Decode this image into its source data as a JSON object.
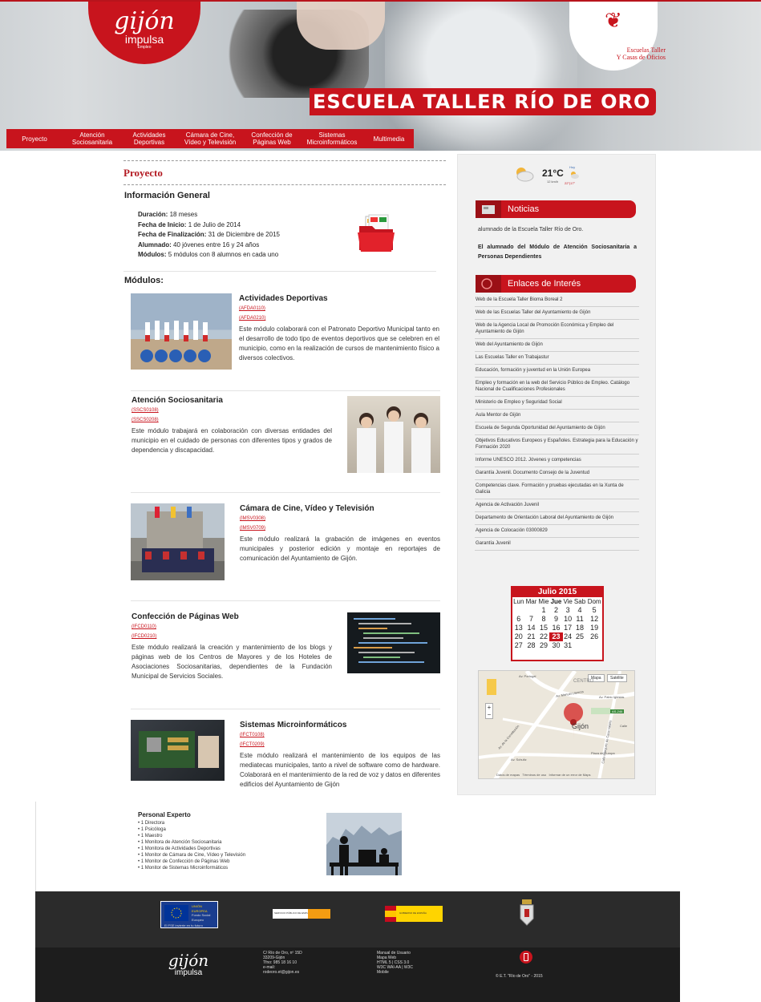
{
  "header": {
    "logo_gijon": {
      "main": "gijón",
      "sub": "impulsa",
      "tag": "Empleo"
    },
    "logo_et": {
      "line1": "Escuelas Taller",
      "line2": "Y Casas de Oficios"
    },
    "banner": "ESCUELA TALLER RÍO DE ORO"
  },
  "nav": {
    "items": [
      {
        "label": "Proyecto"
      },
      {
        "label": "Atención Sociosanitaria"
      },
      {
        "label": "Actividades Deportivas"
      },
      {
        "label": "Cámara de Cine, Vídeo y Televisión"
      },
      {
        "label": "Confección de Páginas Web"
      },
      {
        "label": "Sistemas Microinformáticos"
      },
      {
        "label": "Multimedia"
      }
    ]
  },
  "main": {
    "section_title": "Proyecto",
    "info_heading": "Información General",
    "info": [
      {
        "key": "Duración:",
        "value": " 18 meses"
      },
      {
        "key": "Fecha de Inicio:",
        "value": " 1 de Julio de 2014"
      },
      {
        "key": "Fecha de Finalización:",
        "value": " 31 de Diciembre de 2015"
      },
      {
        "key": "Alumnado:",
        "value": " 40 jóvenes entre 16 y 24 años"
      },
      {
        "key": "Módulos:",
        "value": " 5 módulos con 8 alumnos en cada uno"
      }
    ],
    "modules_heading": "Módulos:",
    "modules": [
      {
        "title": "Actividades Deportivas",
        "codes": [
          "(AFDA0110)",
          "(AFDA0210)"
        ],
        "desc": "Este módulo colaborará con el Patronato Deportivo Municipal tanto en el desarrollo de todo tipo de eventos deportivos que se celebren en el municipio, como en la realización de cursos de mantenimiento físico a diversos colectivos."
      },
      {
        "title": "Atención Sociosanitaria",
        "codes": [
          "(SSCS0108)",
          "(SSCS0208)"
        ],
        "desc": "Este módulo trabajará en colaboración con diversas entidades del municipio en el cuidado de personas con diferentes tipos y grados de dependencia y discapacidad."
      },
      {
        "title": "Cámara de Cine, Vídeo y Televisión",
        "codes": [
          "(IMSV0308)",
          "(IMSV0709)"
        ],
        "desc": "Este módulo realizará la grabación de imágenes en eventos municipales y posterior edición y montaje en reportajes de comunicación del Ayuntamiento de Gijón."
      },
      {
        "title": "Confección de Páginas Web",
        "codes": [
          "(IFCD0110)",
          "(IFCD0210)"
        ],
        "desc": "Este módulo realizará la creación y mantenimiento de los blogs y páginas web de los Centros de Mayores y de los Hoteles de Asociaciones Sociosanitarias, dependientes de la Fundación Municipal de Servicios Sociales."
      },
      {
        "title": "Sistemas Microinformáticos",
        "codes": [
          "(IFCT0108)",
          "(IFCT0209)"
        ],
        "desc": "Este módulo realizará el mantenimiento de los equipos de las mediatecas municipales, tanto a nivel de software como de hardware. Colaborará en el mantenimiento de la red de voz y datos en diferentes edificios del Ayuntamiento de Gijón"
      }
    ],
    "staff": {
      "title": "Personal Experto",
      "items": [
        "1 Directora",
        "1 Psicóloga",
        "1 Maestro",
        "1 Monitora de Atención Sociosanitaria",
        "1 Monitora de Actividades Deportivas",
        "1 Monitor de Cámara de Cine, Vídeo y Televisión",
        "1 Monitor de Confección de Páginas Web",
        "1 Monitor de Sistemas Microinformáticos"
      ]
    }
  },
  "sidebar": {
    "weather": {
      "temp": "21°C",
      "wind": "12 km/h",
      "today": "Hoy",
      "hilo": "22°|17°"
    },
    "news": {
      "title": "Noticias",
      "item1": "alumnado de la Escuela Taller Río de Oro.",
      "item2": "El alumnado del Módulo de Atención Sociosanitaria a Personas Dependientes"
    },
    "links": {
      "title": "Enlaces de Interés",
      "items": [
        "Web de la Escuela Taller Bioma Boreal 2",
        "Web de las Escuelas Taller del Ayuntamiento de Gijón",
        "Web de la Agencia Local de Promoción Económica y Empleo del Ayuntamiento de Gijón",
        "Web del Ayuntamiento de Gijón",
        "Las Escuelas Taller en Trabajastur",
        "Educación, formación y juventud en la Unión Europea",
        "Empleo y formación en la web del Servicio Público de Empleo. Catálogo Nacional de Cualificaciones Profesionales",
        "Ministerio de Empleo y Seguridad Social",
        "Aula Mentor de Gijón",
        "Escuela de Segunda Oportunidad del Ayuntamiento de Gijón",
        "Objetivos Educativos Europeos y Españoles. Estrategia para la Educación y Formación 2020",
        "Informe UNESCO 2012. Jóvenes y competencias",
        "Garantía Juvenil. Documento Consejo de la Juventud",
        "Competencias clave. Formación y pruebas ejecutadas en la Xunta de Galicia",
        "Agencia de Activación Juvenil",
        "Departamento de Orientación Laboral del Ayuntamiento de Gijón",
        "Agencia de Colocación 03000829",
        "Garantía Juvenil"
      ]
    },
    "calendar": {
      "title": "Julio 2015",
      "weekdays": [
        "Lun",
        "Mar",
        "Mie",
        "Jue",
        "Vie",
        "Sab",
        "Dom"
      ],
      "weeks": [
        [
          "",
          "",
          "1",
          "2",
          "3",
          "4",
          "5"
        ],
        [
          "6",
          "7",
          "8",
          "9",
          "10",
          "11",
          "12"
        ],
        [
          "13",
          "14",
          "15",
          "16",
          "17",
          "18",
          "19"
        ],
        [
          "20",
          "21",
          "22",
          "23",
          "24",
          "25",
          "26"
        ],
        [
          "27",
          "28",
          "29",
          "30",
          "31",
          "",
          ""
        ]
      ],
      "today": "23"
    },
    "map": {
      "btn_map": "Mapa",
      "btn_sat": "Satélite",
      "labels": [
        "CENTRO",
        "Av. Portugal",
        "Av. Manuel Llaneza",
        "Av. Pablo Iglesias",
        "Av. de la Constitución",
        "Gijón",
        "Calle Marqués de Casa Valdés",
        "Plaza de Europa",
        "Calle",
        "Av. Schultz"
      ],
      "footer": "Datos de mapas   Términos de uso   Informar de un error de Maps",
      "badge": "AS-246"
    }
  },
  "footer": {
    "eu_text1": "UNIÓN EUROPEA",
    "eu_text2": "Fondo Social Europeo",
    "eu_text3": "El FSE invierte en tu futuro",
    "sepe_text": "SERVICIO PÚBLICO DE EMPLEO ESTATAL",
    "ministry_text": "GOBIERNO DE ESPAÑA",
    "gijon": "gijón",
    "impulsa": "impulsa",
    "address": [
      "C/ Río de Oro, nº 15D",
      "33209-Gijón",
      "Tfno: 985 18 16 10",
      "e-mail:",
      "rodeoro.et@gijon.es"
    ],
    "links": [
      "Manual de Usuario",
      "Mapa Web",
      "HTML 5 | CSS 3.0",
      "W3C WAI-AA | W3C",
      "Mobile"
    ],
    "copyright": "© E.T. \"Río de Oro\" - 2015"
  },
  "colors": {
    "brand": "#c8141d",
    "footer": "#2b2b2b"
  }
}
